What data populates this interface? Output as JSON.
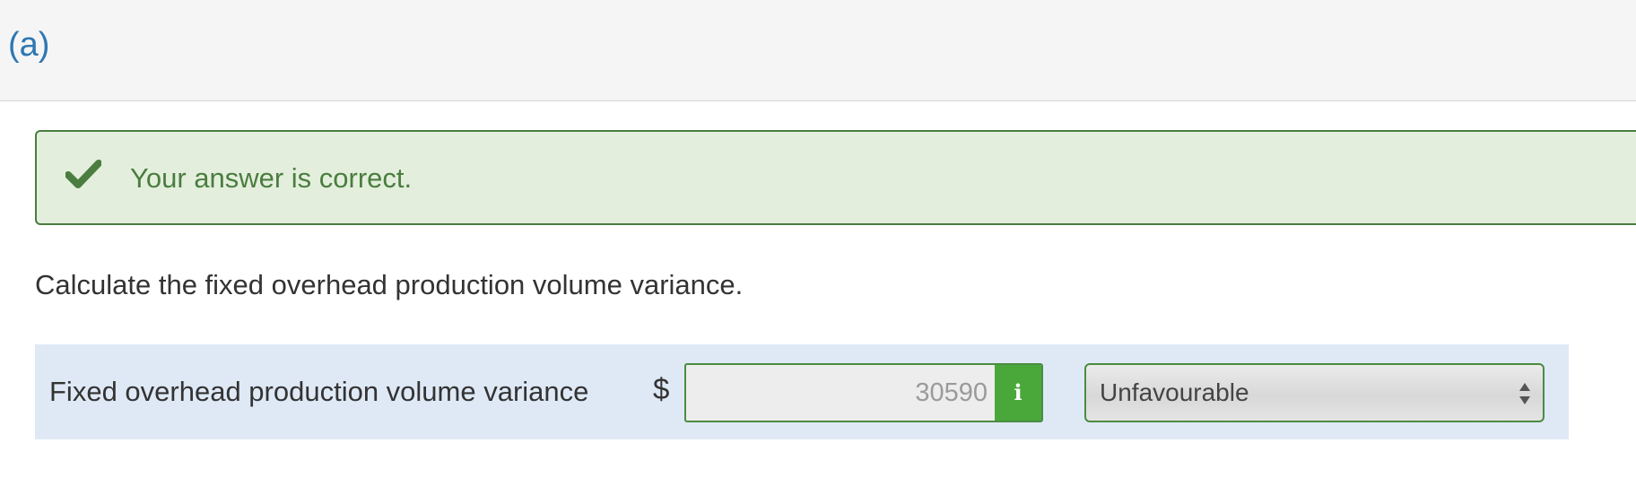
{
  "part": {
    "label": "(a)"
  },
  "feedback": {
    "icon": "check-icon",
    "message": "Your answer is correct.",
    "color": "#4a7d3f",
    "background": "#e3efdc"
  },
  "question": {
    "text": "Calculate the fixed overhead production volume variance."
  },
  "answer_row": {
    "label": "Fixed overhead production volume variance",
    "currency_symbol": "$",
    "amount_value": "30590",
    "info_icon": "info-icon",
    "info_button_color": "#4aa83a",
    "variance_type": {
      "selected": "Unfavourable",
      "icon": "select-arrows-icon"
    }
  }
}
